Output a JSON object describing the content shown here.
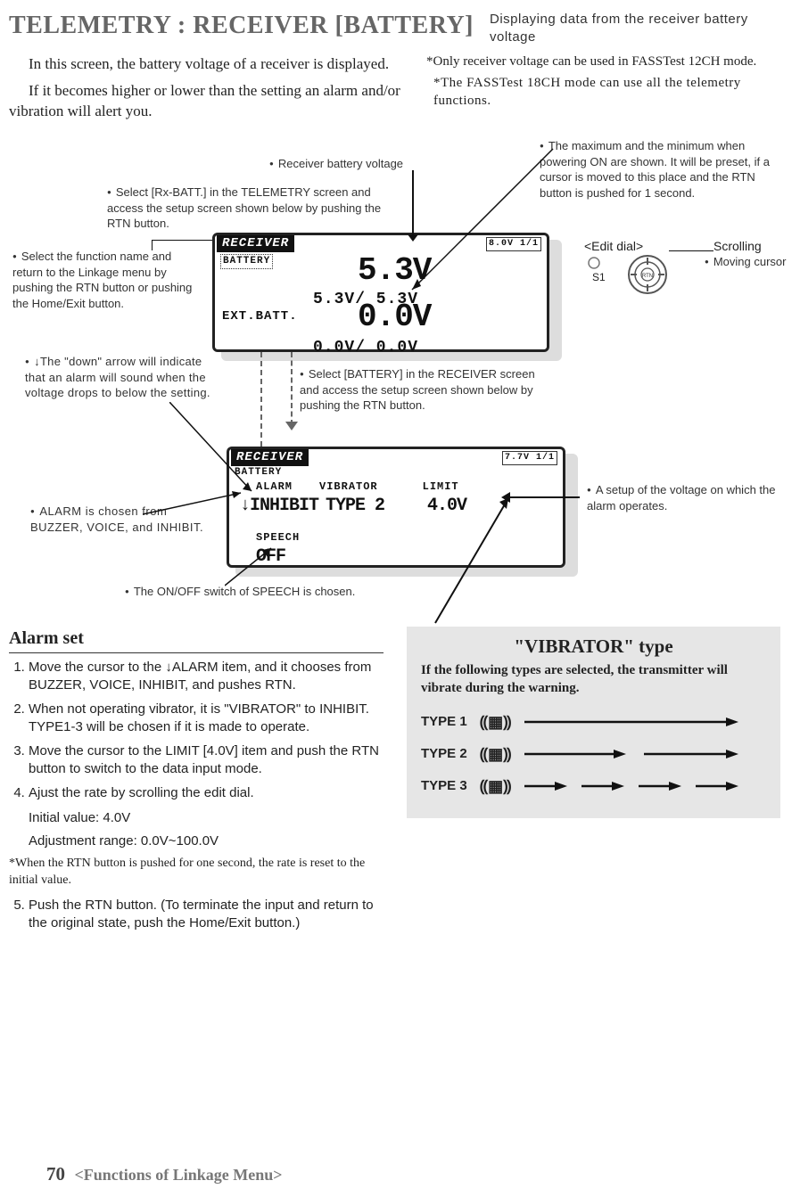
{
  "header": {
    "title": "TELEMETRY : RECEIVER [BATTERY]",
    "subtitle": "Displaying data from the receiver battery voltage"
  },
  "intro": {
    "left_p1": "In this screen, the battery voltage of a receiver is displayed.",
    "left_p2": "If it becomes higher or lower than the setting  an alarm and/or vibration will alert you.",
    "right_n1": "*Only receiver voltage can be used in FASSTest 12CH mode.",
    "right_n2": "*The FASSTest 18CH mode can use all the telemetry functions."
  },
  "callouts": {
    "rx_batt_voltage": "Receiver battery voltage",
    "select_rx_batt": "Select [Rx-BATT.] in the TELEMETRY screen and access the setup screen shown below by pushing the RTN button.",
    "max_min": "The maximum and the minimum when powering ON are shown. It will be preset, if a cursor is moved to this place and the RTN button is pushed for 1 second.",
    "edit_dial": "<Edit dial>",
    "scrolling": "Scrolling",
    "moving_cursor": "Moving cursor",
    "s1": "S1",
    "rtn": "RTN",
    "select_function_name": "Select the function name and return to the Linkage menu by pushing the RTN button or pushing the Home/Exit button.",
    "down_arrow": "↓The \"down\" arrow will indicate that an alarm will sound when the voltage drops to below the setting.",
    "select_battery": "Select [BATTERY] in the RECEIVER screen and access the setup screen shown below by pushing the RTN button.",
    "voltage_setup": "A setup of the voltage on which the alarm operates.",
    "alarm_chosen": "ALARM is chosen from BUZZER, VOICE, and INHIBIT.",
    "speech_switch": "The ON/OFF switch of SPEECH is chosen."
  },
  "lcd1": {
    "title": "RECEIVER",
    "sub": "BATTERY",
    "corner": "8.0V 1/1",
    "main1_big": "5.3V",
    "main1_small": "5.3V/   5.3V",
    "ext_label": "EXT.BATT.",
    "main2_big": "0.0V",
    "main2_small": "0.0V/   0.0V"
  },
  "lcd2": {
    "title": "RECEIVER",
    "sub": "BATTERY",
    "corner": "7.7V 1/1",
    "col_alarm": "ALARM",
    "col_vib": "VIBRATOR",
    "col_limit": "LIMIT",
    "alarm_val": "↓INHIBIT",
    "vib_val": "TYPE 2",
    "limit_val": "4.0V",
    "speech_label": "SPEECH",
    "speech_val": "OFF"
  },
  "alarm_set": {
    "heading": "Alarm set",
    "step1": "Move the cursor to the ↓ALARM  item, and it chooses from BUZZER, VOICE, INHIBIT, and pushes RTN.",
    "step2": "When not operating vibrator, it is \"VIBRATOR\" to INHIBIT. TYPE1-3 will be chosen if it is made to operate.",
    "step3": "Move the cursor to the LIMIT [4.0V] item and push the RTN button to switch to the data input mode.",
    "step4": "Ajust the rate by scrolling the edit dial.",
    "initial": "Initial value: 4.0V",
    "range": "Adjustment range: 0.0V~100.0V",
    "note": "*When the RTN button is pushed for one second, the rate is reset to the initial value.",
    "step5": "Push the RTN button. (To terminate the input and return to the original state, push the Home/Exit button.)"
  },
  "vibrator_panel": {
    "title": "\"VIBRATOR\" type",
    "subtitle": "If the following types are selected, the transmitter will vibrate during the warning.",
    "type1": "TYPE 1",
    "type2": "TYPE 2",
    "type3": "TYPE 3"
  },
  "footer": {
    "page": "70",
    "section": "<Functions of Linkage Menu>"
  }
}
